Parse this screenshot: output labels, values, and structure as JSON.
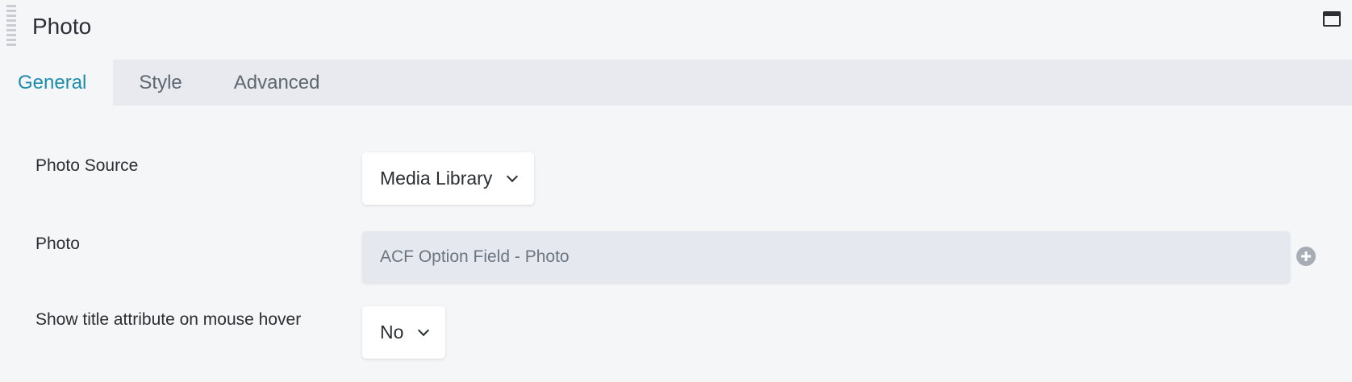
{
  "header": {
    "title": "Photo",
    "drag_handle_icon": "drag-handle-icon",
    "window_icon": "maximize-window-icon"
  },
  "tabs": [
    {
      "label": "General",
      "active": true
    },
    {
      "label": "Style",
      "active": false
    },
    {
      "label": "Advanced",
      "active": false
    }
  ],
  "colors": {
    "accent": "#1e8cab",
    "background": "#f5f6f8",
    "tab_bar": "#e8eaf0"
  },
  "form": {
    "photo_source": {
      "label": "Photo Source",
      "value": "Media Library"
    },
    "photo": {
      "label": "Photo",
      "value": "ACF Option Field - Photo",
      "action_icon": "plus-circle-icon"
    },
    "show_title": {
      "label": "Show title attribute on mouse hover",
      "value": "No"
    }
  }
}
